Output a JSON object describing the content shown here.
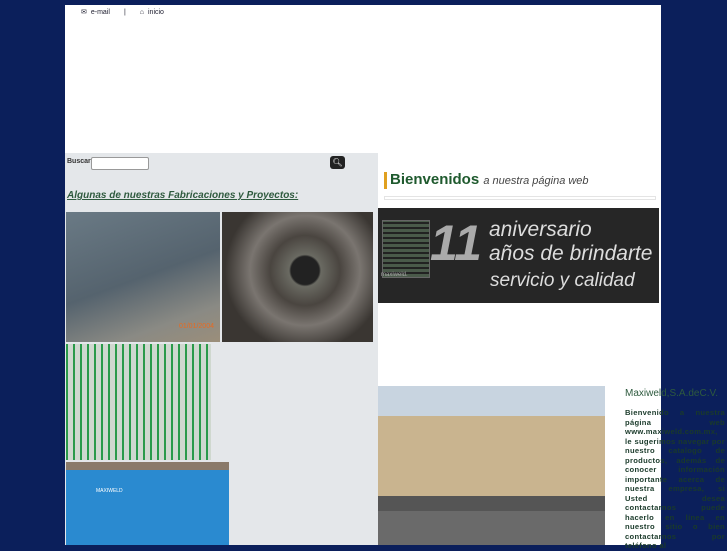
{
  "nav": {
    "email": "e-mail",
    "separator": "|",
    "home": "inicio"
  },
  "search": {
    "label": "Buscar:",
    "value": "",
    "button_icon": "search-icon"
  },
  "left": {
    "heading": "Algunas de nuestras Fabricaciones y Proyectos:",
    "photo_date": "01/01/2004",
    "basket_brand": "MAXIWELD"
  },
  "welcome": {
    "title": "Bienvenidos",
    "subtitle": "a nuestra página web"
  },
  "banner": {
    "number": "11",
    "line1": "aniversario",
    "line2": "años de brindarte",
    "line3": "servicio y calidad",
    "logo_text": "maxiweld."
  },
  "company": {
    "name": "Maxiweld,S.A.deC.V.",
    "text": "Bienvenido a nuestra página web www.maxiweld.com.mx, le sugerimos navegar por nuestro catalogo de productos, además de conocer información importante acerca de nuestra empresa, si Usted desea contactarnos puede hacerlo en línea en nuestro sitio o bien contactarnos por teléfono al"
  },
  "colors": {
    "background": "#0b1f5b",
    "accent": "#2e5a3e"
  }
}
